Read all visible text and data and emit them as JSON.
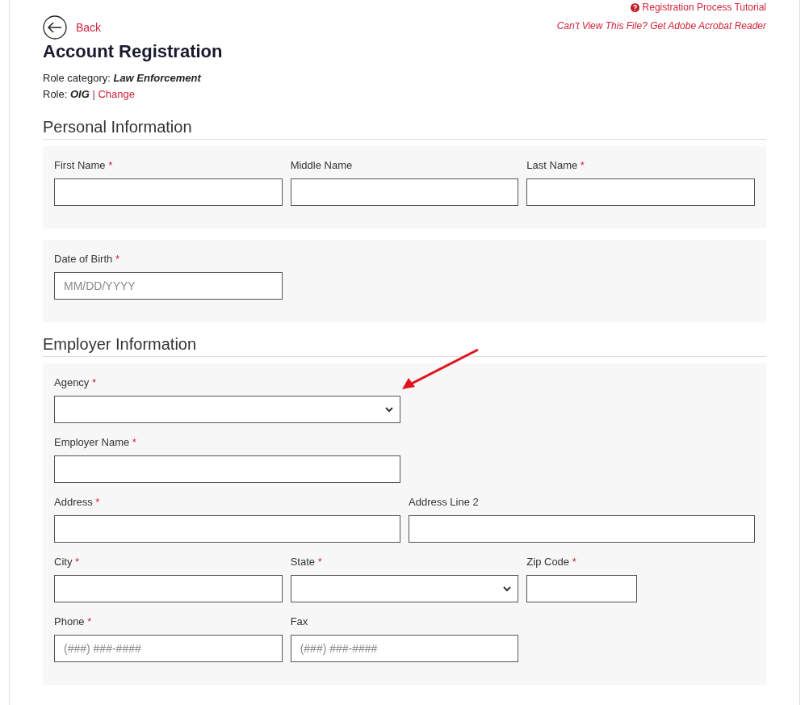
{
  "top_links": {
    "tutorial": "Registration Process Tutorial",
    "acrobat": "Can't View This File? Get Adobe Acrobat Reader"
  },
  "back": "Back",
  "title": "Account Registration",
  "role_category": {
    "label": "Role category:",
    "value": "Law Enforcement"
  },
  "role": {
    "label": "Role:",
    "value": "OIG",
    "separator": "|",
    "change": "Change"
  },
  "sections": [
    {
      "title": "Personal Information",
      "cards": [
        {
          "rows": [
            [
              {
                "label": "First Name",
                "mark": "*",
                "kind": "text"
              },
              {
                "label": "Middle Name",
                "kind": "text"
              },
              {
                "label": "Last Name",
                "mark": "*",
                "kind": "text"
              }
            ]
          ]
        },
        {
          "rows": [
            [
              {
                "label": "Date of Birth",
                "mark": "*",
                "kind": "text",
                "placeholder": "MM/DD/YYYY"
              }
            ]
          ]
        }
      ]
    },
    {
      "title": "Employer Information",
      "cards": [
        {
          "rows": [
            [
              {
                "label": "Agency",
                "mark": "*",
                "kind": "select"
              }
            ],
            [
              {
                "label": "Employer Name",
                "mark": "*",
                "kind": "text"
              }
            ],
            [
              {
                "label": "Address",
                "mark": "*",
                "kind": "text"
              },
              {
                "label": "Address Line 2",
                "kind": "text"
              }
            ],
            [
              {
                "label": "City",
                "mark": "*",
                "kind": "text"
              },
              {
                "label": "State",
                "mark": "*",
                "kind": "select"
              },
              {
                "label": "Zip Code",
                "mark": "*",
                "kind": "text"
              }
            ],
            [
              {
                "label": "Phone",
                "mark": "*",
                "kind": "text",
                "placeholder": "(###) ###-####"
              },
              {
                "label": "Fax",
                "kind": "text",
                "placeholder": "(###) ###-####"
              }
            ]
          ]
        }
      ]
    }
  ]
}
